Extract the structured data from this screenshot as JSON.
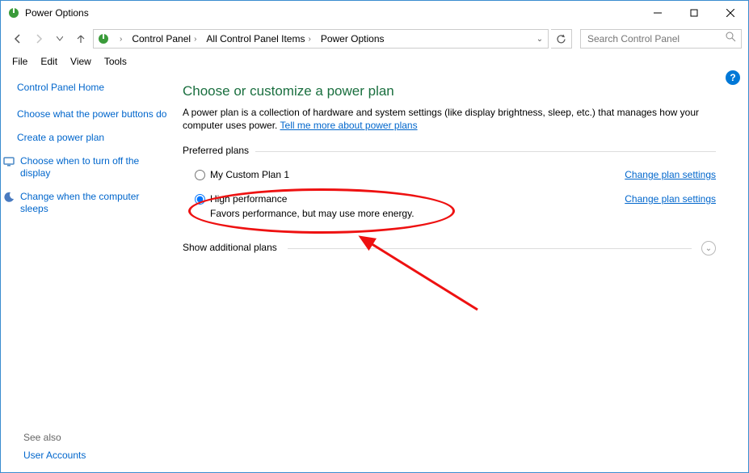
{
  "window": {
    "title": "Power Options"
  },
  "breadcrumb": {
    "items": [
      "Control Panel",
      "All Control Panel Items",
      "Power Options"
    ]
  },
  "search": {
    "placeholder": "Search Control Panel"
  },
  "menu": {
    "items": [
      "File",
      "Edit",
      "View",
      "Tools"
    ]
  },
  "sidebar": {
    "home": "Control Panel Home",
    "links": [
      "Choose what the power buttons do",
      "Create a power plan",
      "Choose when to turn off the display",
      "Change when the computer sleeps"
    ]
  },
  "see_also": {
    "label": "See also",
    "link": "User Accounts"
  },
  "main": {
    "heading": "Choose or customize a power plan",
    "desc_a": "A power plan is a collection of hardware and system settings (like display brightness, sleep, etc.) that manages how your computer uses power. ",
    "desc_link": "Tell me more about power plans",
    "preferred_label": "Preferred plans",
    "additional_label": "Show additional plans",
    "change_label": "Change plan settings",
    "plans": [
      {
        "name": "My Custom Plan 1",
        "subtitle": "",
        "selected": false
      },
      {
        "name": "High performance",
        "subtitle": "Favors performance, but may use more energy.",
        "selected": true
      }
    ]
  },
  "help": {
    "glyph": "?"
  }
}
